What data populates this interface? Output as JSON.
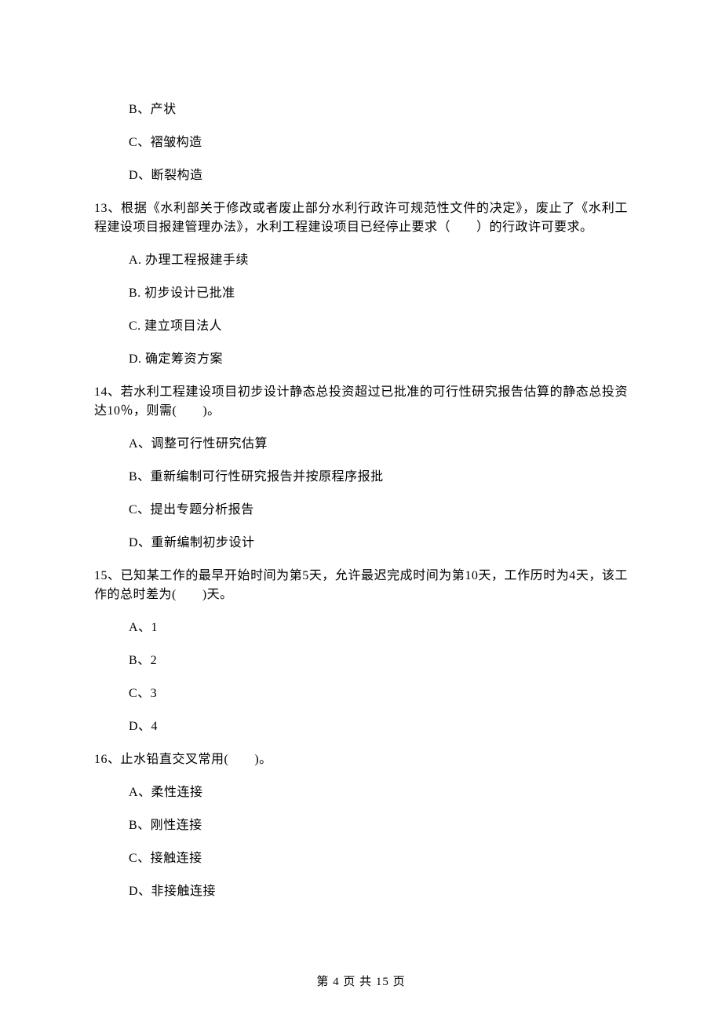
{
  "carryover_options": {
    "B": "B、产状",
    "C": "C、褶皱构造",
    "D": "D、断裂构造"
  },
  "q13": {
    "stem": "13、根据《水利部关于修改或者废止部分水利行政许可规范性文件的决定》，废止了《水利工程建设项目报建管理办法》，水利工程建设项目已经停止要求（　　）的行政许可要求。",
    "A": "A.  办理工程报建手续",
    "B": "B.  初步设计已批准",
    "C": "C.  建立项目法人",
    "D": "D.  确定筹资方案"
  },
  "q14": {
    "stem": "14、若水利工程建设项目初步设计静态总投资超过已批准的可行性研究报告估算的静态总投资达10％，则需(　　)。",
    "A": "A、调整可行性研究估算",
    "B": "B、重新编制可行性研究报告并按原程序报批",
    "C": "C、提出专题分析报告",
    "D": "D、重新编制初步设计"
  },
  "q15": {
    "stem": "15、已知某工作的最早开始时间为第5天，允许最迟完成时间为第10天，工作历时为4天，该工作的总时差为(　　)天。",
    "A": "A、1",
    "B": "B、2",
    "C": "C、3",
    "D": "D、4"
  },
  "q16": {
    "stem": "16、止水铅直交叉常用(　　)。",
    "A": "A、柔性连接",
    "B": "B、刚性连接",
    "C": "C、接触连接",
    "D": "D、非接触连接"
  },
  "footer": "第 4 页 共 15 页"
}
